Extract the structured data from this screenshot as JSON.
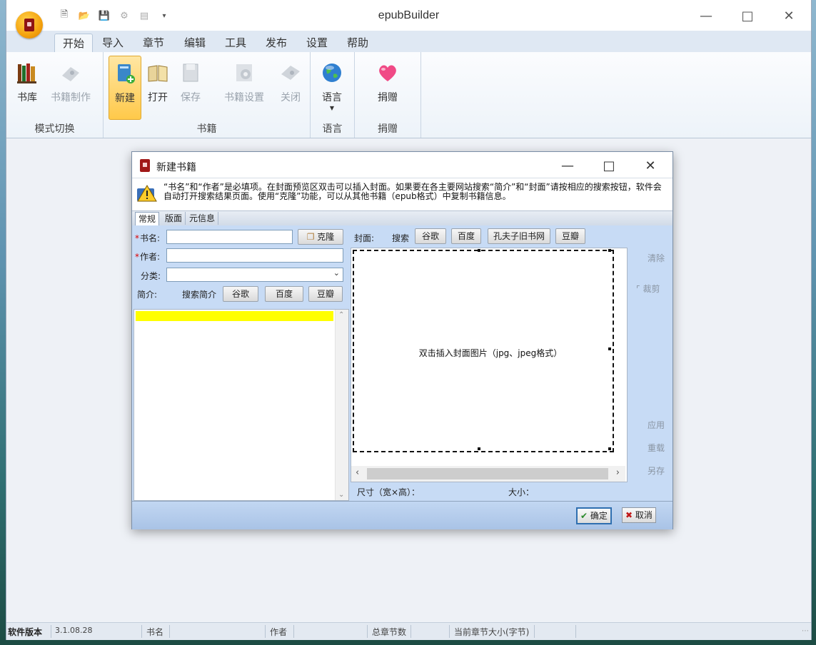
{
  "app": {
    "title": "epubBuilder",
    "tabs": [
      "开始",
      "导入",
      "章节",
      "编辑",
      "工具",
      "发布",
      "设置",
      "帮助"
    ],
    "active_tab": "开始"
  },
  "ribbon": {
    "groups": [
      {
        "label": "模式切换",
        "buttons": [
          "书库",
          "书籍制作"
        ]
      },
      {
        "label": "书籍",
        "buttons": [
          "新建",
          "打开",
          "保存",
          "书籍设置",
          "关闭"
        ]
      },
      {
        "label": "语言",
        "buttons": [
          "语言"
        ]
      },
      {
        "label": "捐赠",
        "buttons": [
          "捐赠"
        ]
      }
    ]
  },
  "dialog": {
    "title": "新建书籍",
    "hint": "“书名”和“作者”是必填项。在封面预览区双击可以插入封面。如果要在各主要网站搜索“简介”和“封面”请按相应的搜索按钮，软件会自动打开搜索结果页面。使用“克隆”功能，可以从其他书籍（epub格式）中复制书籍信息。",
    "tabs": [
      "常规",
      "版面",
      "元信息"
    ],
    "form": {
      "book_name_label": "书名:",
      "author_label": "作者:",
      "category_label": "分类:",
      "intro_label": "简介:",
      "search_intro_label": "搜索简介",
      "clone_button": "克隆",
      "search_google": "谷歌",
      "search_baidu": "百度",
      "search_douban": "豆瓣"
    },
    "cover": {
      "label": "封面:",
      "search_label": "搜索",
      "search_google": "谷歌",
      "search_baidu": "百度",
      "search_kongfz": "孔夫子旧书网",
      "search_douban": "豆瓣",
      "placeholder": "双击插入封面图片（jpg、jpeg格式）",
      "size_label": "尺寸（宽×高）：",
      "filesize_label": "大小：",
      "side_clear": "清除",
      "side_crop": "裁剪",
      "side_apply": "应用",
      "side_reload": "重载",
      "side_save": "另存"
    },
    "ok_button": "确定",
    "cancel_button": "取消"
  },
  "statusbar": {
    "version_label": "软件版本",
    "version": "3.1.08.28",
    "book_name": "书名",
    "author": "作者",
    "total_chapters": "总章节数",
    "chapter_size": "当前章节大小(字节)"
  }
}
